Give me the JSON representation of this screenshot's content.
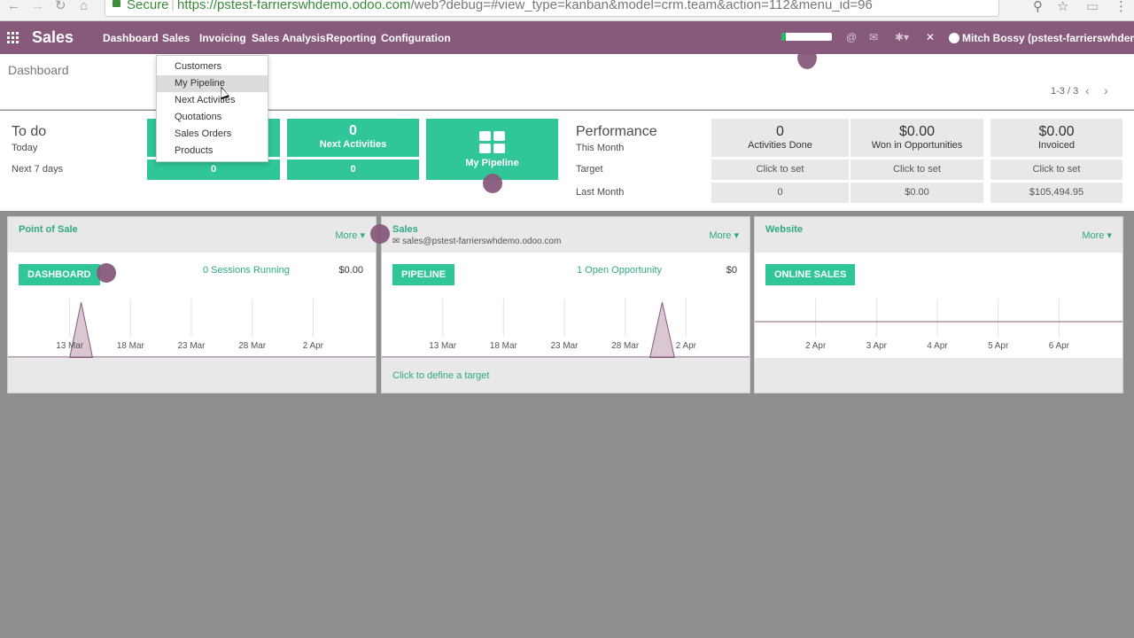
{
  "browser": {
    "secure": "Secure",
    "url_host": "https://pstest-farrierswhdemo.odoo.com",
    "url_path": "/web?debug=#view_type=kanban&model=crm.team&action=112&menu_id=96"
  },
  "topbar": {
    "brand": "Sales",
    "menu": [
      "Dashboard",
      "Sales",
      "Invoicing",
      "Sales Analysis",
      "Reporting",
      "Configuration"
    ],
    "user": "Mitch Bossy (pstest-farrierswhdemo)",
    "progress": 0.08
  },
  "panel": {
    "breadcrumb": "Dashboard",
    "pager": "1-3 / 3"
  },
  "dropdown": {
    "items": [
      "Customers",
      "My Pipeline",
      "Next Activities",
      "Quotations",
      "Sales Orders",
      "Products"
    ],
    "active_index": 1
  },
  "todo": {
    "title": "To do",
    "today": "Today",
    "next7": "Next 7 days",
    "next_activities": {
      "count": "0",
      "label": "Next Activities",
      "next7": "0"
    },
    "first_tile_next7": "0",
    "pipeline_label": "My Pipeline"
  },
  "performance": {
    "title": "Performance",
    "this_month": "This Month",
    "target": "Target",
    "last_month": "Last Month",
    "columns": [
      {
        "value": "0",
        "label": "Activities Done",
        "target": "Click to set",
        "last": "0"
      },
      {
        "value": "$0.00",
        "label": "Won in Opportunities",
        "target": "Click to set",
        "last": "$0.00"
      },
      {
        "value": "$0.00",
        "label": "Invoiced",
        "target": "Click to set",
        "last": "$105,494.95"
      }
    ]
  },
  "cards": [
    {
      "name": "Point of Sale",
      "more": "More ▾",
      "button": "DASHBOARD",
      "info": "0 Sessions Running",
      "amount": "$0.00",
      "ticks": [
        "13 Mar",
        "18 Mar",
        "23 Mar",
        "28 Mar",
        "2 Apr"
      ]
    },
    {
      "name": "Sales",
      "email": "sales@pstest-farrierswhdemo.odoo.com",
      "more": "More ▾",
      "button": "PIPELINE",
      "info": "1 Open Opportunity",
      "amount": "$0",
      "ticks": [
        "13 Mar",
        "18 Mar",
        "23 Mar",
        "28 Mar",
        "2 Apr"
      ],
      "footer": "Click to define a target"
    },
    {
      "name": "Website",
      "more": "More ▾",
      "button": "ONLINE SALES",
      "ticks": [
        "2 Apr",
        "3 Apr",
        "4 Apr",
        "5 Apr",
        "6 Apr"
      ]
    }
  ],
  "colors": {
    "brand": "#875a7b",
    "accent": "#30c69a",
    "link": "#30a885"
  }
}
